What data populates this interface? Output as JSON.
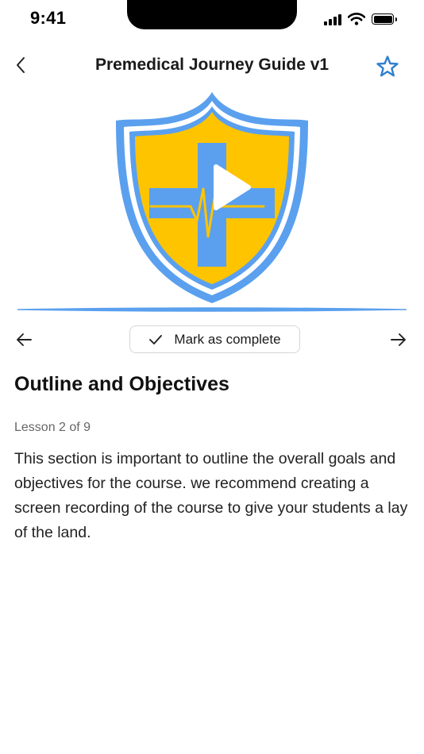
{
  "status_bar": {
    "time": "9:41"
  },
  "nav": {
    "title": "Premedical Journey Guide v1",
    "back_icon": "chevron-left-icon",
    "favorite_icon": "star-outline-icon"
  },
  "video": {
    "thumbnail": "medical-shield-logo",
    "play_icon": "play-icon"
  },
  "lesson_nav": {
    "prev_icon": "arrow-left-icon",
    "next_icon": "arrow-right-icon",
    "complete_label": "Mark as complete",
    "complete_icon": "checkmark-icon"
  },
  "lesson": {
    "title": "Outline and Objectives",
    "progress": "Lesson 2 of 9",
    "body": "This section is important to outline the overall goals and objectives for the course. we recommend creating a screen recording of the course to give your students a lay of the land."
  },
  "colors": {
    "accent_blue": "#2f7fd0",
    "shield_blue": "#5aa0ee",
    "shield_gold": "#ffc400",
    "border_gray": "#d6d6d6"
  }
}
